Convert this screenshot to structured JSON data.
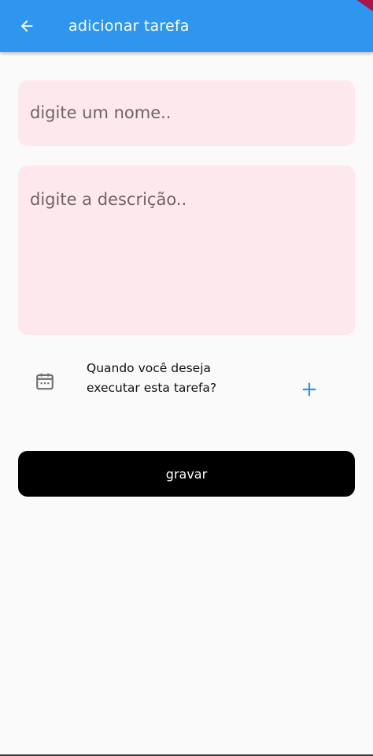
{
  "appbar": {
    "title": "adicionar tarefa",
    "back_icon": "arrow-left-icon",
    "background_color": "#2f96ef"
  },
  "form": {
    "name_placeholder": "digite um nome..",
    "description_placeholder": "digite a descrição..",
    "field_background_color": "#fce8ed"
  },
  "date_row": {
    "calendar_icon": "calendar-icon",
    "question": "Quando você deseja executar esta tarefa?",
    "add_icon": "plus-icon",
    "accent_color": "#2f96ef"
  },
  "actions": {
    "save_label": "gravar",
    "save_background_color": "#000000"
  }
}
